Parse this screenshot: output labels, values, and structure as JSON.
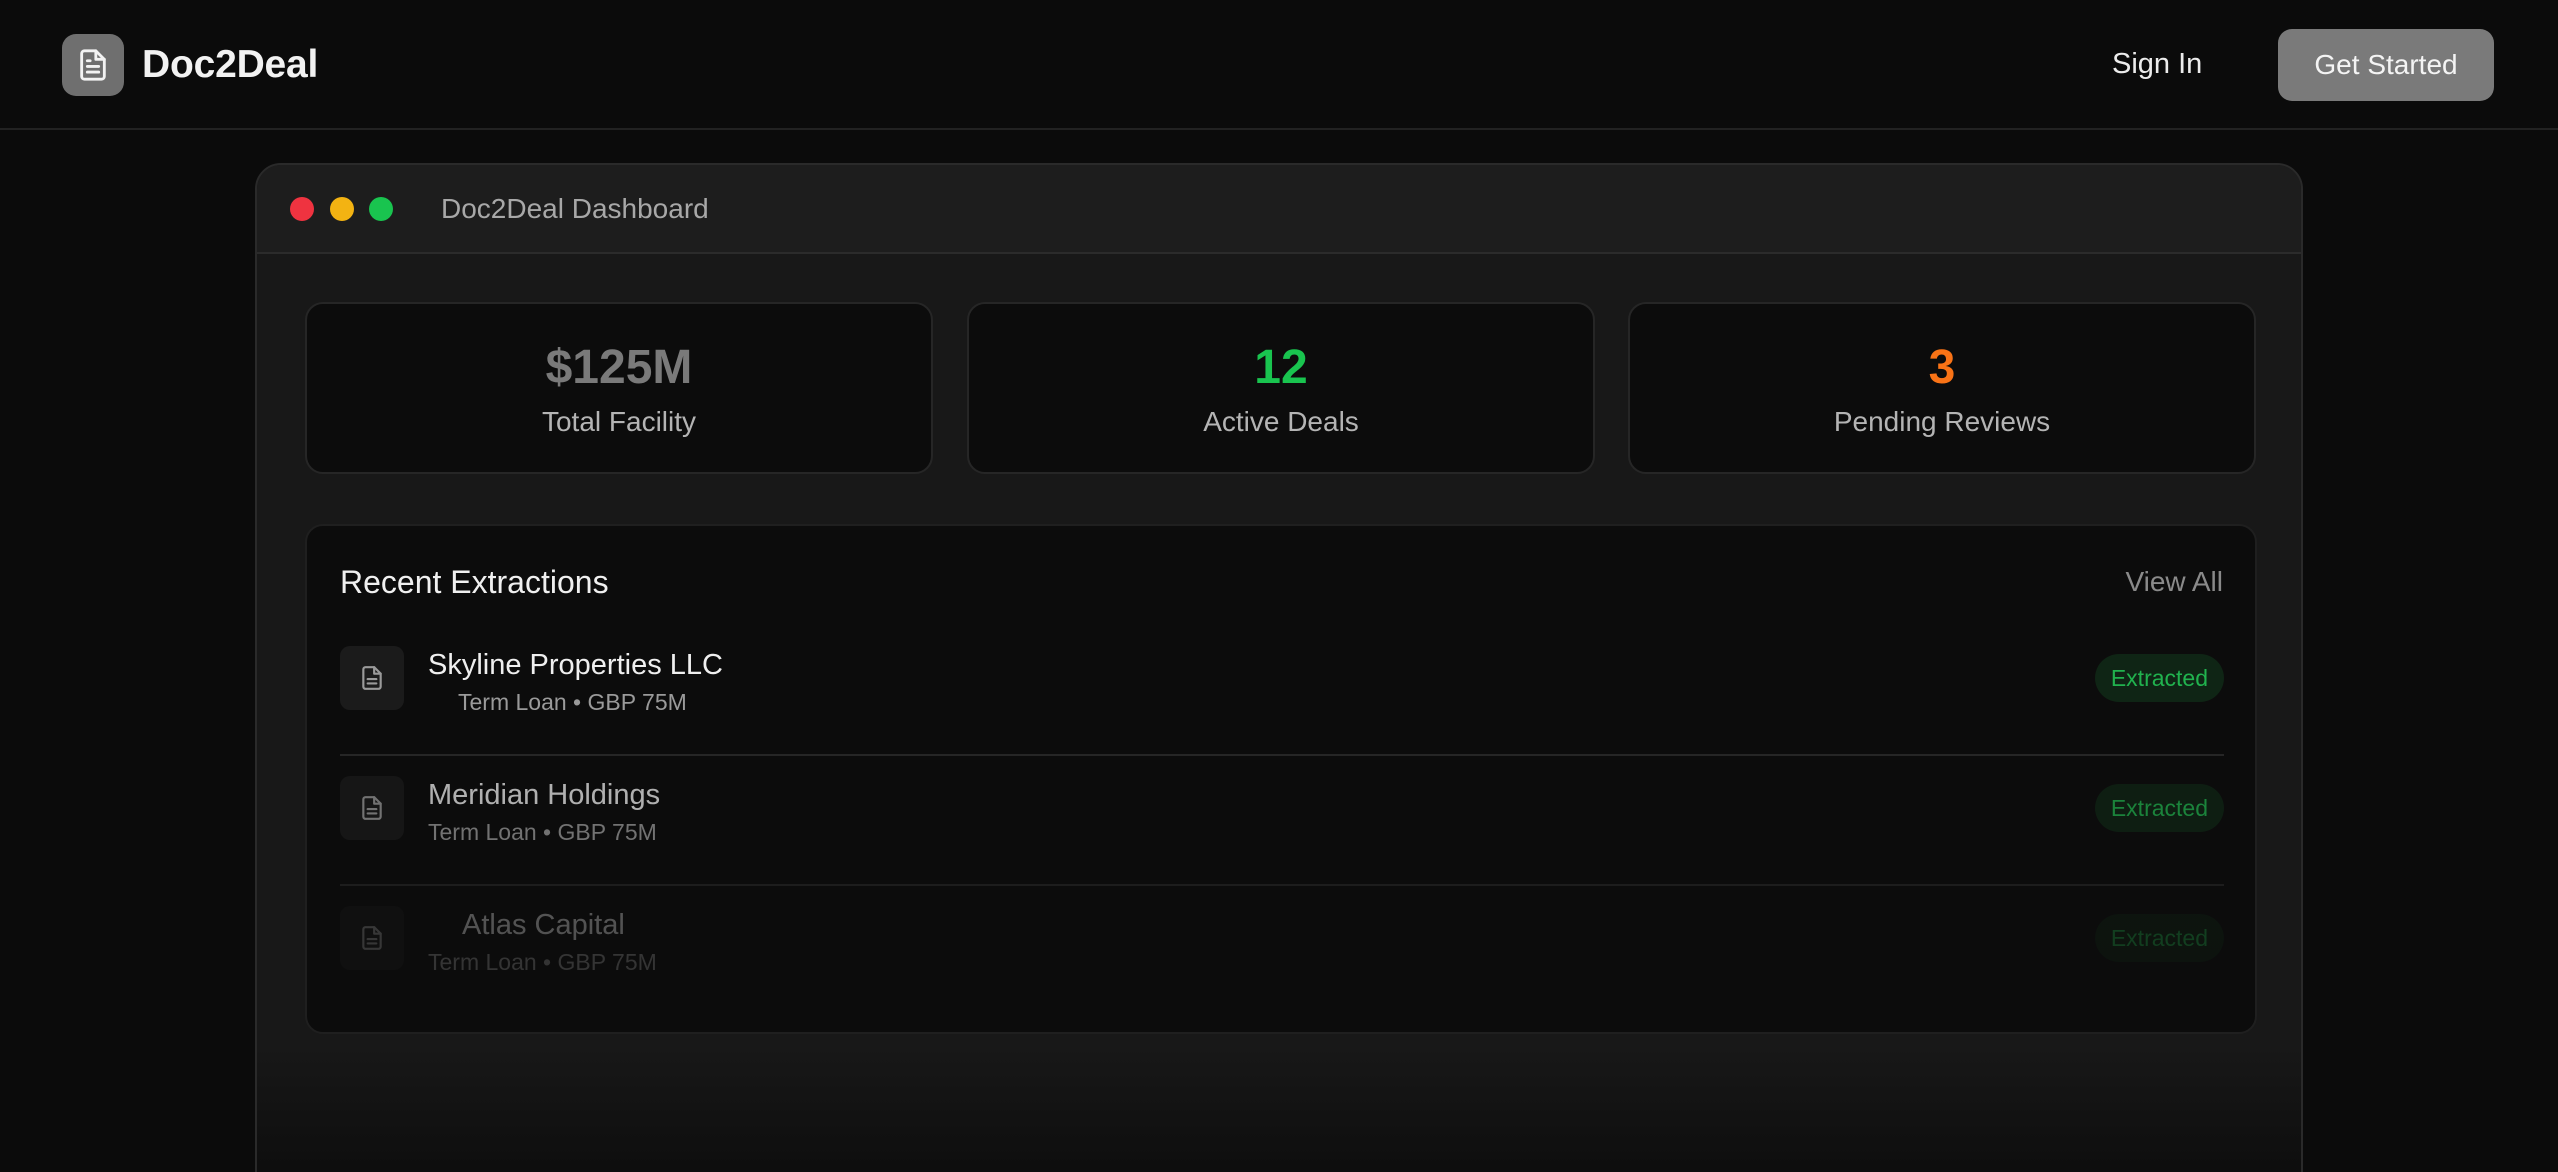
{
  "header": {
    "brand": "Doc2Deal",
    "logo_icon": "document-icon",
    "sign_in_label": "Sign In",
    "get_started_label": "Get Started"
  },
  "dashboard": {
    "window_title": "Doc2Deal Dashboard",
    "stats": [
      {
        "value": "$125M",
        "label": "Total Facility",
        "color": "#7a7a7a"
      },
      {
        "value": "12",
        "label": "Active Deals",
        "color": "#19c44f"
      },
      {
        "value": "3",
        "label": "Pending Reviews",
        "color": "#f97316"
      }
    ],
    "recent": {
      "title": "Recent Extractions",
      "view_all_label": "View All",
      "items": [
        {
          "name": "Skyline Properties LLC",
          "details": "Term Loan • GBP 75M",
          "status": "Extracted",
          "icon": "document-icon"
        },
        {
          "name": "Meridian Holdings",
          "details": "Term Loan • GBP 75M",
          "status": "Extracted",
          "icon": "document-icon"
        },
        {
          "name": "Atlas Capital",
          "details": "Term Loan • GBP 75M",
          "status": "Extracted",
          "icon": "document-icon"
        }
      ]
    }
  }
}
